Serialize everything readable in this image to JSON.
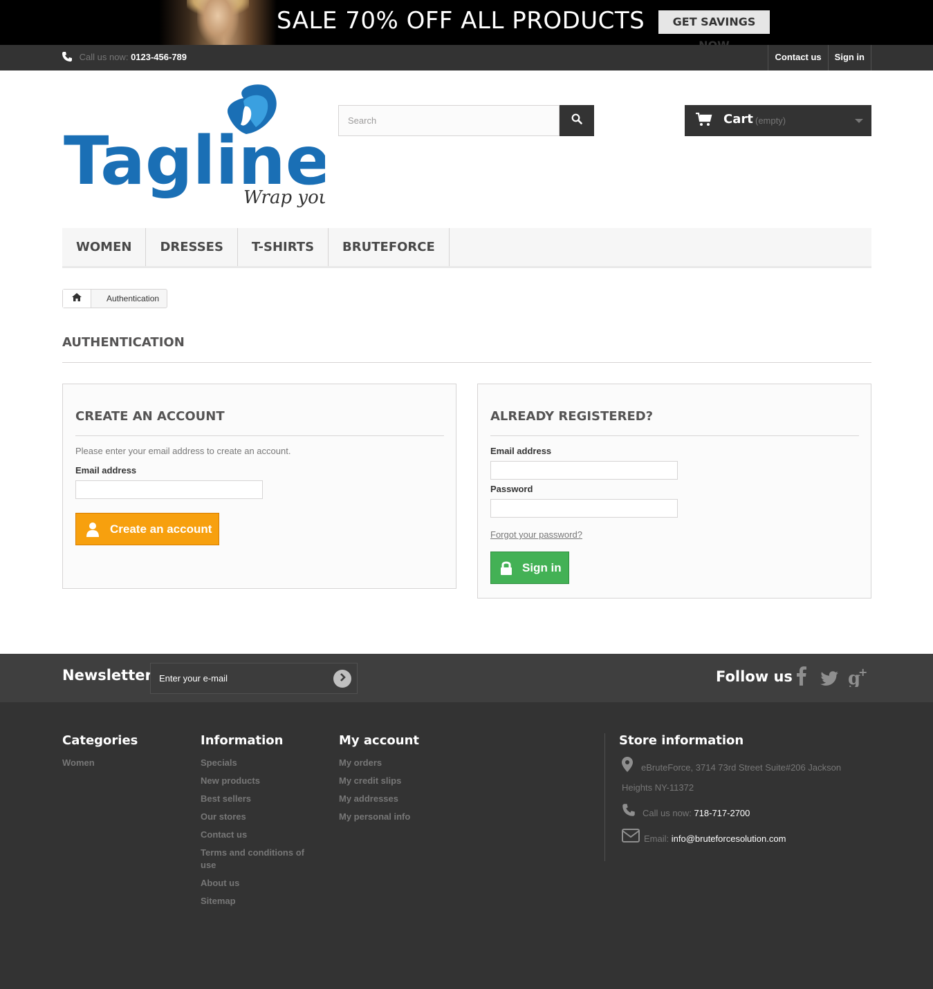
{
  "banner": {
    "text": "SALE 70% OFF ALL PRODUCTS",
    "button": "GET SAVINGS NOW"
  },
  "topbar": {
    "phone_label": "Call us now:",
    "phone_number": "0123-456-789",
    "links": [
      "Contact us",
      "Sign in"
    ]
  },
  "logo": {
    "name": "Tagline",
    "tagline": "Wrap you",
    "color": "#1a6fb5"
  },
  "search": {
    "placeholder": "Search"
  },
  "cart": {
    "label": "Cart",
    "status": "(empty)"
  },
  "menu": [
    "WOMEN",
    "DRESSES",
    "T-SHIRTS",
    "BRUTEFORCE"
  ],
  "breadcrumb": {
    "current": "Authentication"
  },
  "page": {
    "heading": "AUTHENTICATION"
  },
  "create_account": {
    "title": "CREATE AN ACCOUNT",
    "intro": "Please enter your email address to create an account.",
    "email_label": "Email address",
    "email_value": "",
    "button": "Create an account",
    "button_color": "#f7a00e"
  },
  "login": {
    "title": "ALREADY REGISTERED?",
    "email_label": "Email address",
    "email_value": "",
    "password_label": "Password",
    "password_value": "",
    "forgot": "Forgot your password?",
    "button": "Sign in",
    "button_color": "#43b155"
  },
  "newsletter": {
    "title": "Newsletter",
    "placeholder": "Enter your e-mail"
  },
  "social": {
    "title": "Follow us",
    "icons": [
      "facebook-icon",
      "twitter-icon",
      "google-plus-icon"
    ]
  },
  "footer": {
    "categories": {
      "title": "Categories",
      "links": [
        "Women"
      ]
    },
    "information": {
      "title": "Information",
      "links": [
        "Specials",
        "New products",
        "Best sellers",
        "Our stores",
        "Contact us",
        "Terms and conditions of use",
        "About us",
        "Sitemap"
      ]
    },
    "my_account": {
      "title": "My account",
      "links": [
        "My orders",
        "My credit slips",
        "My addresses",
        "My personal info"
      ]
    },
    "store": {
      "title": "Store information",
      "address_line1": "eBruteForce, 3714 73rd Street Suite#206 Jackson",
      "address_line2": "Heights NY-11372",
      "phone_label": "Call us now:",
      "phone": "718-717-2700",
      "email_label": "Email:",
      "email": "info@bruteforcesolution.com"
    }
  }
}
